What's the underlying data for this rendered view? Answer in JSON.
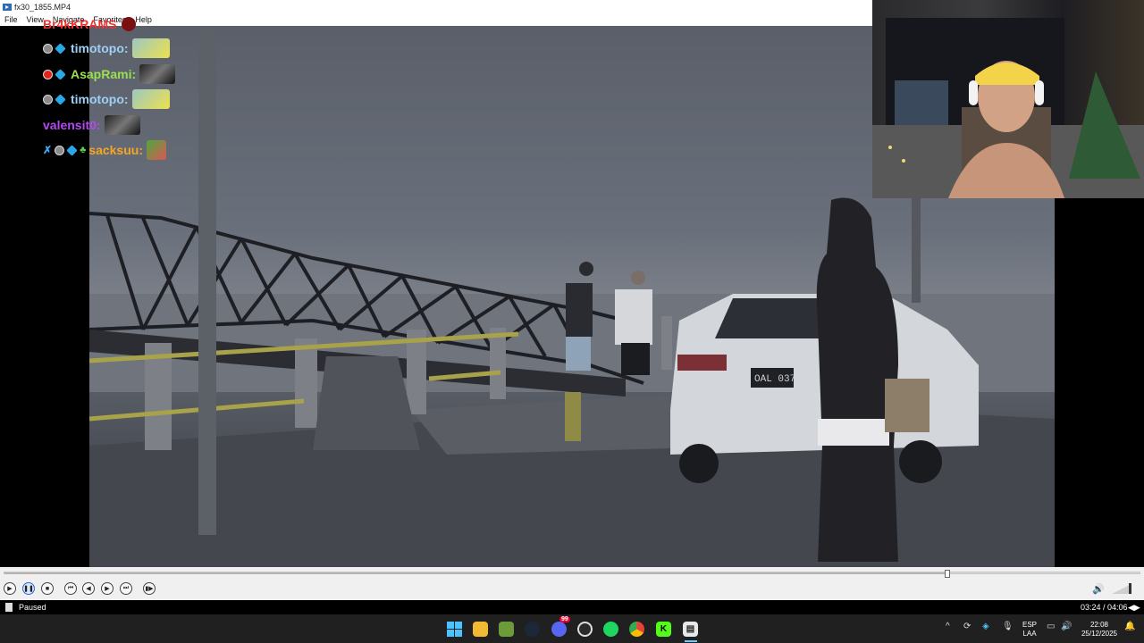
{
  "window": {
    "title": "fx30_1855.MP4"
  },
  "menu": [
    "File",
    "View",
    "Navigate",
    "Favorites",
    "Help"
  ],
  "chat": {
    "top_partial": "Br4kKRAMS",
    "lines": [
      {
        "user": "timotopo:",
        "color": "#9fcff5",
        "badges": [
          "grey",
          "cube"
        ],
        "emote": "emote-1"
      },
      {
        "user": "AsapRami:",
        "color": "#9be04f",
        "badges": [
          "red",
          "cube"
        ],
        "emote": "emote-dark"
      },
      {
        "user": "timotopo:",
        "color": "#9fcff5",
        "badges": [
          "grey",
          "cube"
        ],
        "emote": "emote-1"
      },
      {
        "user": "valensit0:",
        "color": "#b449f0",
        "badges": [],
        "emote": "emote-dark"
      },
      {
        "user": "sacksuu:",
        "color": "#f5a623",
        "badges": [
          "sword",
          "grey",
          "cube",
          "leaf"
        ],
        "emote": "emote-pepe"
      }
    ]
  },
  "player": {
    "progress": 0.83,
    "volume_level": "full",
    "status": "Paused",
    "time": "03:24 / 04:06",
    "buttons": [
      "play-icon",
      "pause-icon",
      "stop-icon",
      "prev-icon",
      "rewind-icon",
      "forward-icon",
      "next-icon",
      "frame-step-icon"
    ]
  },
  "scene": {
    "plate": "OAL 037"
  },
  "taskbar": {
    "apps": [
      "start-icon",
      "file-explorer-icon",
      "minecraft-icon",
      "steam-icon",
      "discord-icon",
      "obs-icon",
      "spotify-icon",
      "chrome-icon",
      "kick-icon",
      "media-player-icon"
    ],
    "discord_badge": "99",
    "language": "ESP",
    "keyboard": "LAA",
    "clock_time": "22:08",
    "clock_date": "25/12/2025"
  }
}
